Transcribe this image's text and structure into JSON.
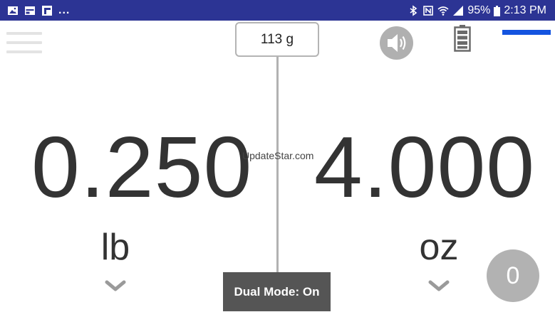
{
  "status_bar": {
    "left_icons": [
      "image-icon",
      "calendar-icon",
      "flipboard-icon"
    ],
    "more_indicator": "...",
    "right_icons": [
      "bluetooth-icon",
      "nfc-icon",
      "wifi-icon",
      "signal-icon"
    ],
    "battery_percent": "95%",
    "time": "2:13 PM"
  },
  "toolbar": {
    "menu_icon": "hamburger-menu-icon",
    "weight_value": "113 g",
    "sound_icon": "speaker-icon",
    "battery_icon": "battery-icon",
    "accent_color": "#1454e0"
  },
  "readings": {
    "left": {
      "value": "0.250",
      "unit": "lb"
    },
    "right": {
      "value": "4.000",
      "unit": "oz"
    }
  },
  "watermark": "UpdateStar.com",
  "dual_mode_label": "Dual Mode: On",
  "zero_label": "0"
}
